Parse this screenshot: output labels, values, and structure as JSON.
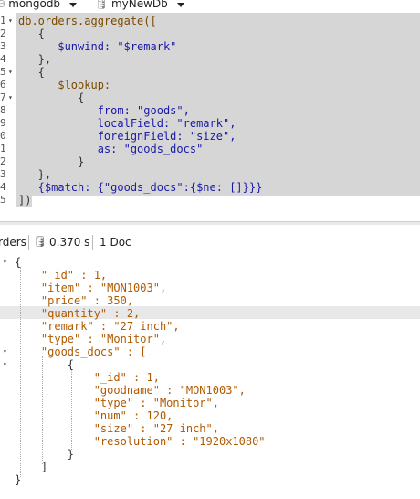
{
  "toolbar": {
    "connection": "mongodb",
    "database": "myNewDb"
  },
  "editor": {
    "line_numbers": [
      "1",
      "2",
      "3",
      "4",
      "5",
      "6",
      "7",
      "8",
      "9",
      "0",
      "1",
      "2",
      "3",
      "4",
      "5"
    ],
    "lines": [
      "db.orders.aggregate([",
      "   {",
      "      $unwind: \"$remark\"",
      "   },",
      "   {",
      "      $lookup:",
      "         {",
      "            from: \"goods\",",
      "            localField: \"remark\",",
      "            foreignField: \"size\",",
      "            as: \"goods_docs\"",
      "         }",
      "   },",
      "   {$match: {\"goods_docs\":{$ne: []}}}",
      "])"
    ]
  },
  "status": {
    "collection": "rders",
    "time": "0.370 s",
    "docs": "1 Doc"
  },
  "result": {
    "lines": [
      "{",
      "    \"_id\" : 1,",
      "    \"item\" : \"MON1003\",",
      "    \"price\" : 350,",
      "    \"quantity\" : 2,",
      "    \"remark\" : \"27 inch\",",
      "    \"type\" : \"Monitor\",",
      "    \"goods_docs\" : [",
      "        {",
      "            \"_id\" : 1,",
      "            \"goodname\" : \"MON1003\",",
      "            \"type\" : \"Monitor\",",
      "            \"num\" : 120,",
      "            \"size\" : \"27 inch\",",
      "            \"resolution\" : \"1920x1080\"",
      "        }",
      "    ]",
      "}"
    ]
  }
}
